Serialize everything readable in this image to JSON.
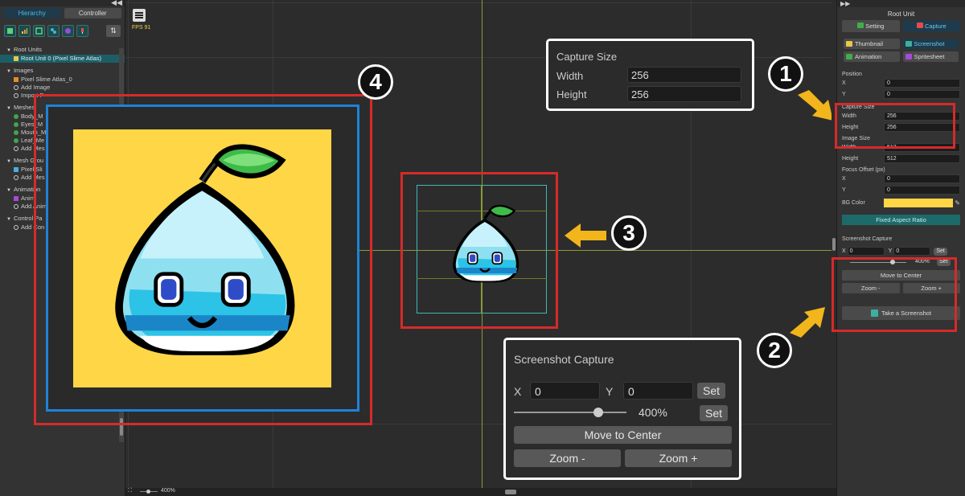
{
  "left_panel": {
    "tabs": [
      "Hierarchy",
      "Controller"
    ],
    "collapse_glyph": "◀◀",
    "sort_glyph": "⇅",
    "tool_icons": [
      "cursor-icon",
      "chart-icon",
      "frame-icon",
      "node-icon",
      "circle-icon",
      "pin-icon"
    ],
    "sections": [
      {
        "title": "Root Units",
        "items": [
          {
            "label": "Root Unit 0 (Pixel Slime Atlas)",
            "kind": "selected"
          }
        ]
      },
      {
        "title": "Images",
        "items": [
          {
            "label": "Pixel Slime Atlas_0",
            "kind": "image"
          },
          {
            "label": "Add Image",
            "kind": "add"
          },
          {
            "label": "Import P",
            "kind": "add"
          }
        ]
      },
      {
        "title": "Meshes",
        "items": [
          {
            "label": "Body_M",
            "kind": "mesh"
          },
          {
            "label": "Eyes_M",
            "kind": "mesh"
          },
          {
            "label": "Mouth_M",
            "kind": "mesh"
          },
          {
            "label": "Leaf_Me",
            "kind": "mesh"
          },
          {
            "label": "Add Mes",
            "kind": "add"
          }
        ]
      },
      {
        "title": "Mesh Grou",
        "items": [
          {
            "label": "Pixel Sli",
            "kind": "group"
          },
          {
            "label": "Add Mes",
            "kind": "add"
          }
        ]
      },
      {
        "title": "Animation",
        "items": [
          {
            "label": "Anim",
            "kind": "anim"
          },
          {
            "label": "Add Anim",
            "kind": "add"
          }
        ]
      },
      {
        "title": "Control Pa",
        "items": [
          {
            "label": "Add Con",
            "kind": "add"
          }
        ]
      }
    ]
  },
  "viewport": {
    "fps": "FPS 91",
    "zoom": "400%"
  },
  "callout_capture": {
    "title": "Capture Size",
    "width_label": "Width",
    "width_value": "256",
    "height_label": "Height",
    "height_value": "256"
  },
  "callout_screenshot": {
    "title": "Screenshot Capture",
    "x_label": "X",
    "x_value": "0",
    "y_label": "Y",
    "y_value": "0",
    "set_label": "Set",
    "zoom_value": "400%",
    "zoom_fraction": 0.75,
    "move_center": "Move to Center",
    "zoom_minus": "Zoom -",
    "zoom_plus": "Zoom +"
  },
  "badges": [
    "1",
    "2",
    "3",
    "4"
  ],
  "right_panel": {
    "collapse_glyph": "▶▶",
    "title": "Root Unit",
    "tabs": [
      "Setting",
      "Capture"
    ],
    "modes": [
      {
        "label": "Thumbnail",
        "color": "#e8c84a",
        "active": false
      },
      {
        "label": "Screenshot",
        "color": "#3fae9e",
        "active": true
      },
      {
        "label": "Animation",
        "color": "#3fae4a",
        "active": false
      },
      {
        "label": "Spritesheet",
        "color": "#a84ad8",
        "active": false
      }
    ],
    "position_label": "Position",
    "pos_x": "0",
    "pos_y": "0",
    "capture_size_label": "Capture Size",
    "capture_width": "256",
    "capture_height": "256",
    "image_size_label": "Image Size",
    "image_width": "512",
    "image_height": "512",
    "focus_label": "Focus Offset (px)",
    "focus_x": "0",
    "focus_y": "0",
    "bg_color_label": "BG Color",
    "bg_color": "#fed646",
    "fixed_aspect": "Fixed Aspect Ratio",
    "ss_title": "Screenshot Capture",
    "ss_x": "0",
    "ss_y": "0",
    "ss_set": "Set",
    "ss_zoom": "400%",
    "ss_move": "Move to Center",
    "ss_zoom_minus": "Zoom -",
    "ss_zoom_plus": "Zoom +",
    "take_screenshot": "Take a Screenshot",
    "width_label": "Width",
    "height_label": "Height",
    "x_label": "X",
    "y_label": "Y"
  }
}
